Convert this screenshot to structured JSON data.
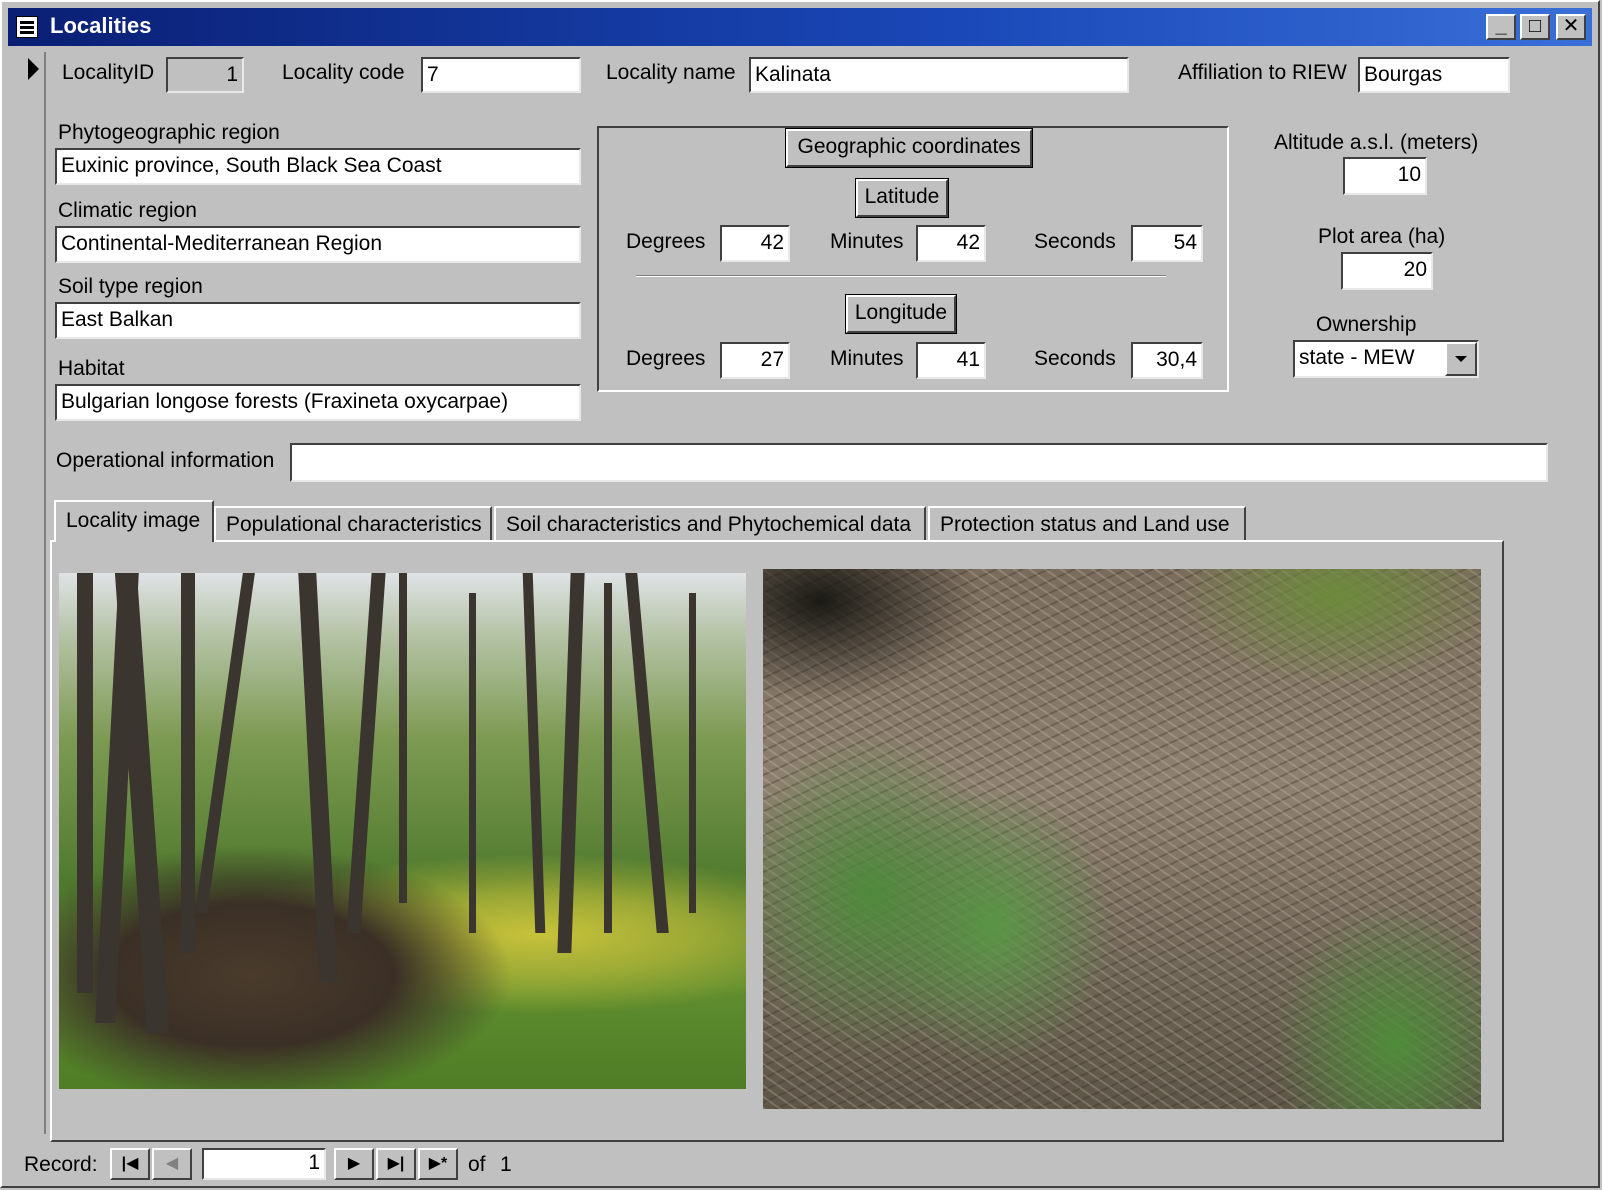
{
  "window": {
    "title": "Localities",
    "minimize": "_",
    "maximize": "□",
    "close": "✕"
  },
  "header": {
    "locality_id_label": "LocalityID",
    "locality_id": "1",
    "locality_code_label": "Locality code",
    "locality_code": "7",
    "locality_name_label": "Locality name",
    "locality_name": "Kalinata",
    "affiliation_label": "Affiliation to RIEW",
    "affiliation": "Bourgas"
  },
  "left": {
    "phyto_label": "Phytogeographic region",
    "phyto": "Euxinic province, South Black Sea Coast",
    "climatic_label": "Climatic region",
    "climatic": "Continental-Mediterranean Region",
    "soil_label": "Soil type region",
    "soil": "East Balkan",
    "habitat_label": "Habitat",
    "habitat": "Bulgarian longose forests (Fraxineta oxycarpae)"
  },
  "coords": {
    "title": "Geographic coordinates",
    "latitude_label": "Latitude",
    "longitude_label": "Longitude",
    "degrees_label": "Degrees",
    "minutes_label": "Minutes",
    "seconds_label": "Seconds",
    "lat_deg": "42",
    "lat_min": "42",
    "lat_sec": "54",
    "lon_deg": "27",
    "lon_min": "41",
    "lon_sec": "30,4"
  },
  "right": {
    "altitude_label": "Altitude a.s.l. (meters)",
    "altitude": "10",
    "plot_area_label": "Plot area (ha)",
    "plot_area": "20",
    "ownership_label": "Ownership",
    "ownership": "state - MEW"
  },
  "operational": {
    "label": "Operational information",
    "value": ""
  },
  "tabs": [
    {
      "label": "Locality image"
    },
    {
      "label": "Populational characteristics"
    },
    {
      "label": "Soil characteristics and Phytochemical data"
    },
    {
      "label": "Protection status and Land use"
    }
  ],
  "navigation": {
    "record_label": "Record:",
    "current": "1",
    "of_label": "of",
    "total": "1",
    "first": "|◀",
    "prev": "◀",
    "next": "▶",
    "last": "▶|",
    "new": "▶*"
  }
}
